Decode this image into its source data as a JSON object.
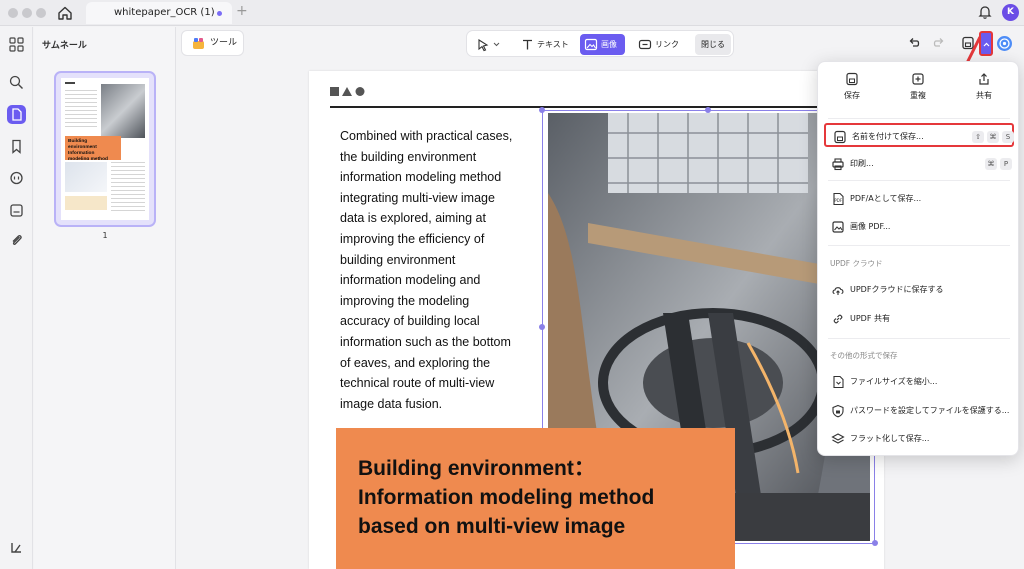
{
  "window": {
    "tab_title": "whitepaper_OCR (1)",
    "new_tab_symbol": "+",
    "avatar_initial": "K"
  },
  "thumbnails": {
    "title": "サムネール",
    "page_number": "1",
    "thumb_title_text": "Building environment Information modeling method based on multi-view image"
  },
  "toolbar": {
    "tools_label": "ツール",
    "text_label": "テキスト",
    "image_label": "画像",
    "link_label": "リンク",
    "close_label": "閉じる"
  },
  "page": {
    "body_text": "Combined with practical cases, the building environment information modeling method integrating multi-view image data is explored, aiming at improving the efficiency of building environment information modeling and improving the modeling accuracy of building local information such as the bottom of eaves, and exploring the technical route of multi-view image data fusion.",
    "banner_title": "Building environment：\nInformation modeling method\nbased on multi-view image"
  },
  "menu": {
    "top_actions": [
      {
        "label": "保存",
        "icon": "save-icon"
      },
      {
        "label": "重複",
        "icon": "duplicate-icon"
      },
      {
        "label": "共有",
        "icon": "share-icon"
      }
    ],
    "save_as": {
      "label": "名前を付けて保存...",
      "keys": [
        "⇧",
        "⌘",
        "S"
      ]
    },
    "print": {
      "label": "印刷...",
      "keys": [
        "⌘",
        "P"
      ]
    },
    "pdfa": {
      "label": "PDF/Aとして保存..."
    },
    "image_pdf": {
      "label": "画像 PDF..."
    },
    "cloud_header": "UPDF クラウド",
    "cloud_save": {
      "label": "UPDFクラウドに保存する"
    },
    "updf_share": {
      "label": "UPDF 共有"
    },
    "other_header": "その他の形式で保存",
    "reduce": {
      "label": "ファイルサイズを縮小..."
    },
    "password": {
      "label": "パスワードを設定してファイルを保護する..."
    },
    "flatten": {
      "label": "フラット化して保存..."
    }
  },
  "colors": {
    "accent": "#6b5cf0",
    "highlight_red": "#e5383b",
    "banner_orange": "#ef8a4f"
  }
}
